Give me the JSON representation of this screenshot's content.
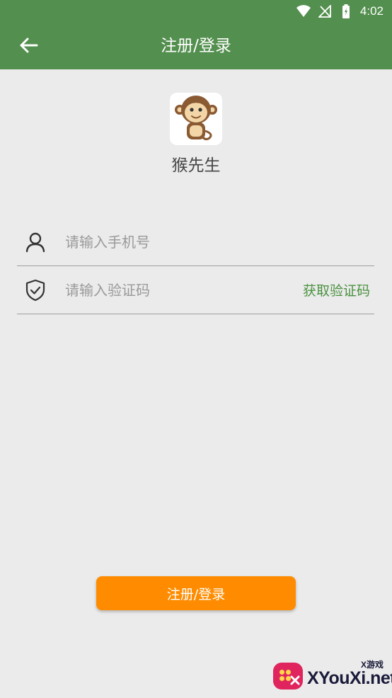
{
  "status_bar": {
    "time": "4:02",
    "icons": [
      "wifi-icon",
      "no-signal-icon",
      "battery-icon"
    ]
  },
  "header": {
    "title": "注册/登录",
    "back_icon": "arrow-left-icon",
    "background": "#538f4e"
  },
  "app": {
    "name": "猴先生",
    "logo_icon": "monkey-icon"
  },
  "form": {
    "phone_placeholder": "请输入手机号",
    "phone_icon": "user-icon",
    "code_placeholder": "请输入验证码",
    "code_icon": "shield-check-icon",
    "get_code_label": "获取验证码"
  },
  "submit": {
    "label": "注册/登录",
    "color": "#ff8c00"
  },
  "watermark": {
    "text": "XYouXi.net",
    "small_text": "X游戏"
  }
}
